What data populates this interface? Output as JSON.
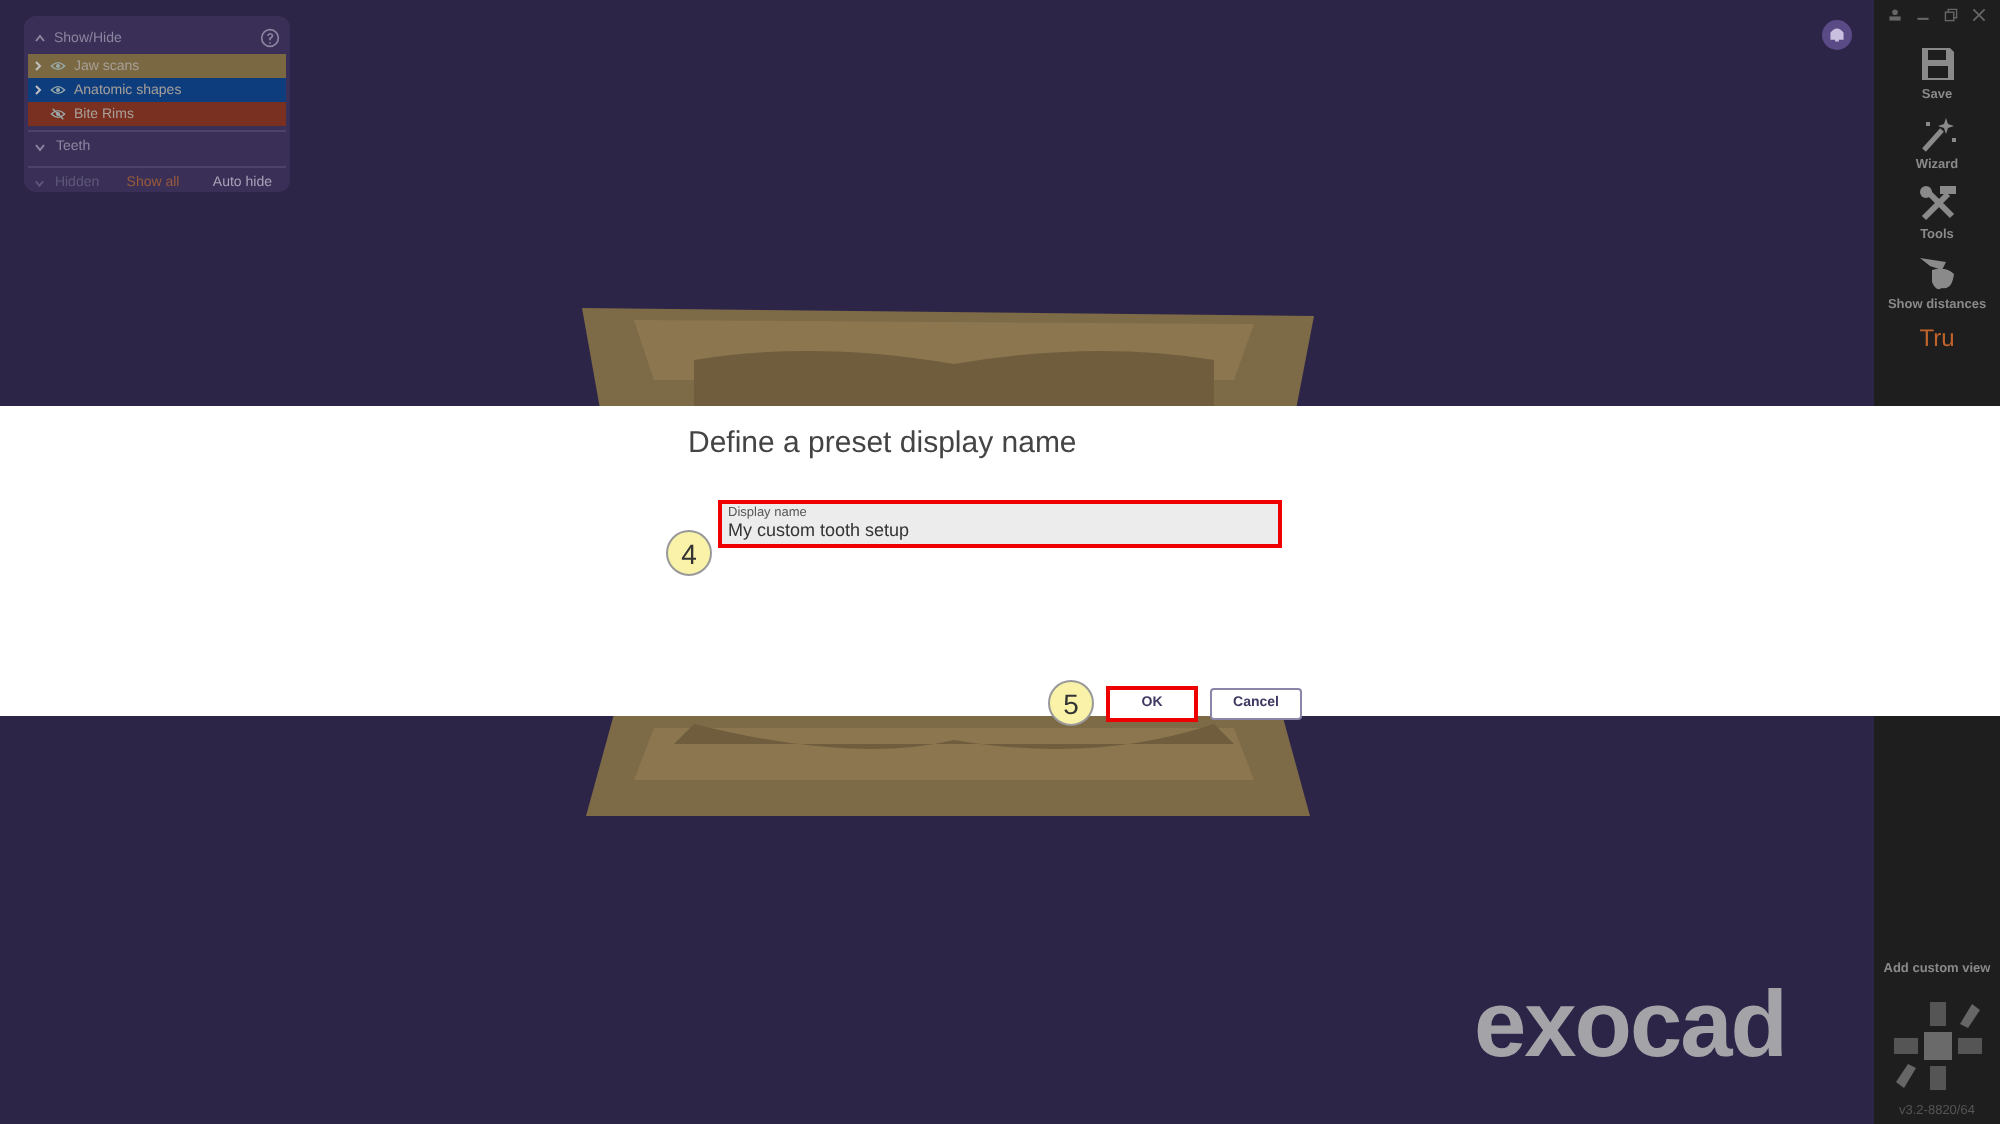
{
  "panel": {
    "title": "Show/Hide",
    "items": [
      {
        "label": "Jaw scans",
        "expandable": true,
        "visible": true,
        "color": "#7a6842"
      },
      {
        "label": "Anatomic shapes",
        "expandable": true,
        "visible": true,
        "color": "#0e3d7e"
      },
      {
        "label": "Bite Rims",
        "expandable": false,
        "visible": false,
        "color": "#7a3020"
      }
    ],
    "sections": [
      {
        "label": "Teeth",
        "expanded": true
      }
    ],
    "hidden": {
      "label": "Hidden",
      "show_all": "Show all",
      "auto_hide": "Auto hide"
    }
  },
  "toolbar": {
    "items": [
      {
        "kind": "save",
        "label": "Save"
      },
      {
        "kind": "wizard",
        "label": "Wizard"
      },
      {
        "kind": "tools",
        "label": "Tools"
      },
      {
        "kind": "distances",
        "label": "Show distances"
      }
    ],
    "logo": "Tru",
    "add_view": "Add custom view",
    "version": "v3.2-8820/64"
  },
  "brand": "exocad",
  "dialog": {
    "title": "Define a preset display name",
    "field": {
      "label": "Display name",
      "value": "My custom tooth setup"
    },
    "buttons": [
      "OK",
      "Cancel"
    ]
  },
  "callouts": [
    "4",
    "5"
  ]
}
